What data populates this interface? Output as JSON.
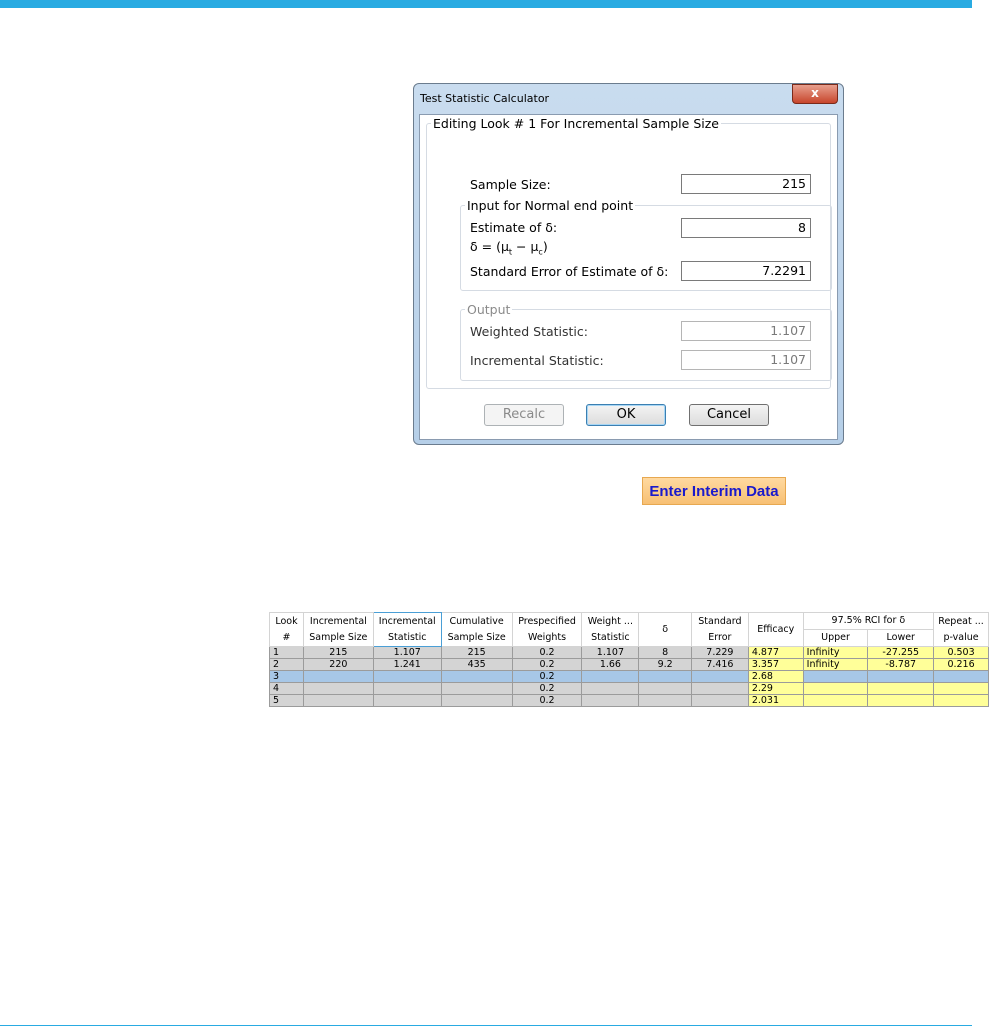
{
  "dialog": {
    "title": "Test Statistic Calculator",
    "close_label": "x",
    "group_title": "Editing Look # 1 For Incremental Sample Size",
    "sample_size_label": "Sample Size:",
    "sample_size_value": "215",
    "input_group_title": "Input for Normal end point",
    "estimate_label": "Estimate of δ:",
    "estimate_value": "8",
    "delta_formula": "δ = (μt − μc)",
    "se_label": "Standard Error of Estimate of δ:",
    "se_value": "7.2291",
    "output_group_title": "Output",
    "weighted_label": "Weighted Statistic:",
    "weighted_value": "1.107",
    "incremental_label": "Incremental Statistic:",
    "incremental_value": "1.107",
    "recalc_label": "Recalc",
    "ok_label": "OK",
    "cancel_label": "Cancel"
  },
  "enter_interim_label": "Enter Interim Data",
  "table": {
    "headers": {
      "look": "Look #",
      "inc_sample": "Incremental Sample Size",
      "inc_stat": "Incremental Statistic",
      "cum_sample": "Cumulative Sample Size",
      "weights": "Prespecified Weights",
      "weight_stat": "Weight ... Statistic",
      "delta": "δ",
      "se": "Standard Error",
      "efficacy": "Efficacy",
      "rci": "97.5% RCI for δ",
      "upper": "Upper",
      "lower": "Lower",
      "repeat": "Repeat ... p-value"
    },
    "rows": [
      {
        "look": "1",
        "inc_sample": "215",
        "inc_stat": "1.107",
        "cum_sample": "215",
        "weights": "0.2",
        "weight_stat": "1.107",
        "delta": "8",
        "se": "7.229",
        "efficacy": "4.877",
        "upper": "Infinity",
        "lower": "-27.255",
        "p": "0.503"
      },
      {
        "look": "2",
        "inc_sample": "220",
        "inc_stat": "1.241",
        "cum_sample": "435",
        "weights": "0.2",
        "weight_stat": "1.66",
        "delta": "9.2",
        "se": "7.416",
        "efficacy": "3.357",
        "upper": "Infinity",
        "lower": "-8.787",
        "p": "0.216"
      },
      {
        "look": "3",
        "inc_sample": "",
        "inc_stat": "",
        "cum_sample": "",
        "weights": "0.2",
        "weight_stat": "",
        "delta": "",
        "se": "",
        "efficacy": "2.68",
        "upper": "",
        "lower": "",
        "p": ""
      },
      {
        "look": "4",
        "inc_sample": "",
        "inc_stat": "",
        "cum_sample": "",
        "weights": "0.2",
        "weight_stat": "",
        "delta": "",
        "se": "",
        "efficacy": "2.29",
        "upper": "",
        "lower": "",
        "p": ""
      },
      {
        "look": "5",
        "inc_sample": "",
        "inc_stat": "",
        "cum_sample": "",
        "weights": "0.2",
        "weight_stat": "",
        "delta": "",
        "se": "",
        "efficacy": "2.031",
        "upper": "",
        "lower": "",
        "p": ""
      }
    ]
  }
}
